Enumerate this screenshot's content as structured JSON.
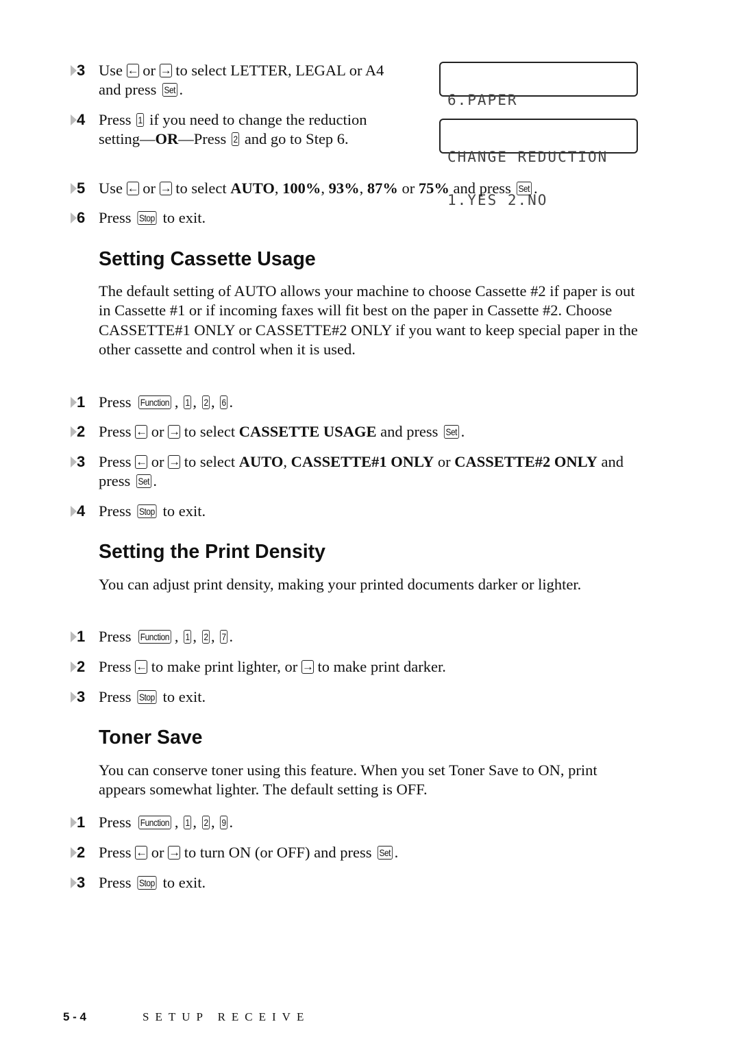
{
  "lcd": {
    "paper": [
      "6.PAPER",
      ""
    ],
    "reduction": [
      "CHANGE REDUCTION",
      "1.YES 2.NO"
    ]
  },
  "top_steps": [
    {
      "number": "3",
      "segments": [
        {
          "t": "Use "
        },
        {
          "icon": "left-arrow-key"
        },
        {
          "t": " or "
        },
        {
          "icon": "right-arrow-key"
        },
        {
          "t": " to select LETTER, LEGAL or A4 and press "
        },
        {
          "k": "Set"
        },
        {
          "t": "."
        }
      ]
    },
    {
      "number": "4",
      "segments": [
        {
          "t": "Press "
        },
        {
          "k": "1"
        },
        {
          "t": " if you need to change the reduction setting—"
        },
        {
          "b": "OR"
        },
        {
          "t": "—Press "
        },
        {
          "k": "2"
        },
        {
          "t": " and go to Step 6."
        }
      ]
    },
    {
      "number": "5",
      "segments": [
        {
          "t": "Use "
        },
        {
          "icon": "left-arrow-key"
        },
        {
          "t": " or "
        },
        {
          "icon": "right-arrow-key"
        },
        {
          "t": " to select "
        },
        {
          "b": "AUTO"
        },
        {
          "t": ", "
        },
        {
          "b": "100%"
        },
        {
          "t": ", "
        },
        {
          "b": "93%"
        },
        {
          "t": ", "
        },
        {
          "b": "87%"
        },
        {
          "t": " or "
        },
        {
          "b": "75%"
        },
        {
          "t": " and press "
        },
        {
          "k": "Set"
        },
        {
          "t": "."
        }
      ]
    },
    {
      "number": "6",
      "segments": [
        {
          "t": "Press "
        },
        {
          "k": "Stop"
        },
        {
          "t": " to exit."
        }
      ]
    }
  ],
  "sections": [
    {
      "heading": "Setting Cassette Usage",
      "paragraph": "The default setting of AUTO allows your machine to choose Cassette #2 if paper is out in Cassette #1 or if incoming faxes will fit best on the paper in Cassette #2. Choose CASSETTE#1 ONLY or CASSETTE#2 ONLY if you want to keep special paper in the other cassette and control when it is used.",
      "steps": [
        {
          "number": "1",
          "segments": [
            {
              "t": "Press "
            },
            {
              "k": "Function"
            },
            {
              "t": ", "
            },
            {
              "k": "1"
            },
            {
              "t": ", "
            },
            {
              "k": "2"
            },
            {
              "t": ", "
            },
            {
              "k": "6"
            },
            {
              "t": "."
            }
          ]
        },
        {
          "number": "2",
          "segments": [
            {
              "t": "Press "
            },
            {
              "icon": "left-arrow-key"
            },
            {
              "t": " or "
            },
            {
              "icon": "right-arrow-key"
            },
            {
              "t": " to select "
            },
            {
              "b": "CASSETTE USAGE"
            },
            {
              "t": " and press "
            },
            {
              "k": "Set"
            },
            {
              "t": "."
            }
          ]
        },
        {
          "number": "3",
          "segments": [
            {
              "t": "Press "
            },
            {
              "icon": "left-arrow-key"
            },
            {
              "t": " or "
            },
            {
              "icon": "right-arrow-key"
            },
            {
              "t": " to select "
            },
            {
              "b": "AUTO"
            },
            {
              "t": ", "
            },
            {
              "b": "CASSETTE#1 ONLY"
            },
            {
              "t": " or "
            },
            {
              "b": "CASSETTE#2 ONLY"
            },
            {
              "t": " and press "
            },
            {
              "k": "Set"
            },
            {
              "t": "."
            }
          ]
        },
        {
          "number": "4",
          "segments": [
            {
              "t": "Press "
            },
            {
              "k": "Stop"
            },
            {
              "t": " to exit."
            }
          ]
        }
      ]
    },
    {
      "heading": "Setting the Print Density",
      "paragraph": "You can adjust print density, making your printed documents darker or lighter.",
      "steps": [
        {
          "number": "1",
          "segments": [
            {
              "t": "Press "
            },
            {
              "k": "Function"
            },
            {
              "t": ", "
            },
            {
              "k": "1"
            },
            {
              "t": ", "
            },
            {
              "k": "2"
            },
            {
              "t": ", "
            },
            {
              "k": "7"
            },
            {
              "t": "."
            }
          ]
        },
        {
          "number": "2",
          "segments": [
            {
              "t": "Press "
            },
            {
              "icon": "left-arrow-key"
            },
            {
              "t": " to make print lighter, or "
            },
            {
              "icon": "right-arrow-key"
            },
            {
              "t": " to make print darker."
            }
          ]
        },
        {
          "number": "3",
          "segments": [
            {
              "t": "Press "
            },
            {
              "k": "Stop"
            },
            {
              "t": " to exit."
            }
          ]
        }
      ]
    },
    {
      "heading": "Toner Save",
      "paragraph": "You can conserve toner using this feature. When you set Toner Save to ON, print appears somewhat lighter. The default setting is OFF.",
      "steps": [
        {
          "number": "1",
          "segments": [
            {
              "t": "Press "
            },
            {
              "k": "Function"
            },
            {
              "t": ", "
            },
            {
              "k": "1"
            },
            {
              "t": ", "
            },
            {
              "k": "2"
            },
            {
              "t": ", "
            },
            {
              "k": "9"
            },
            {
              "t": "."
            }
          ]
        },
        {
          "number": "2",
          "segments": [
            {
              "t": "Press "
            },
            {
              "icon": "left-arrow-key"
            },
            {
              "t": " or "
            },
            {
              "icon": "right-arrow-key"
            },
            {
              "t": " to turn ON (or OFF) and press "
            },
            {
              "k": "Set"
            },
            {
              "t": "."
            }
          ]
        },
        {
          "number": "3",
          "segments": [
            {
              "t": "Press "
            },
            {
              "k": "Stop"
            },
            {
              "t": " to exit."
            }
          ]
        }
      ]
    }
  ],
  "footer": {
    "page": "5 - 4",
    "chapter": "SETUP RECEIVE"
  }
}
